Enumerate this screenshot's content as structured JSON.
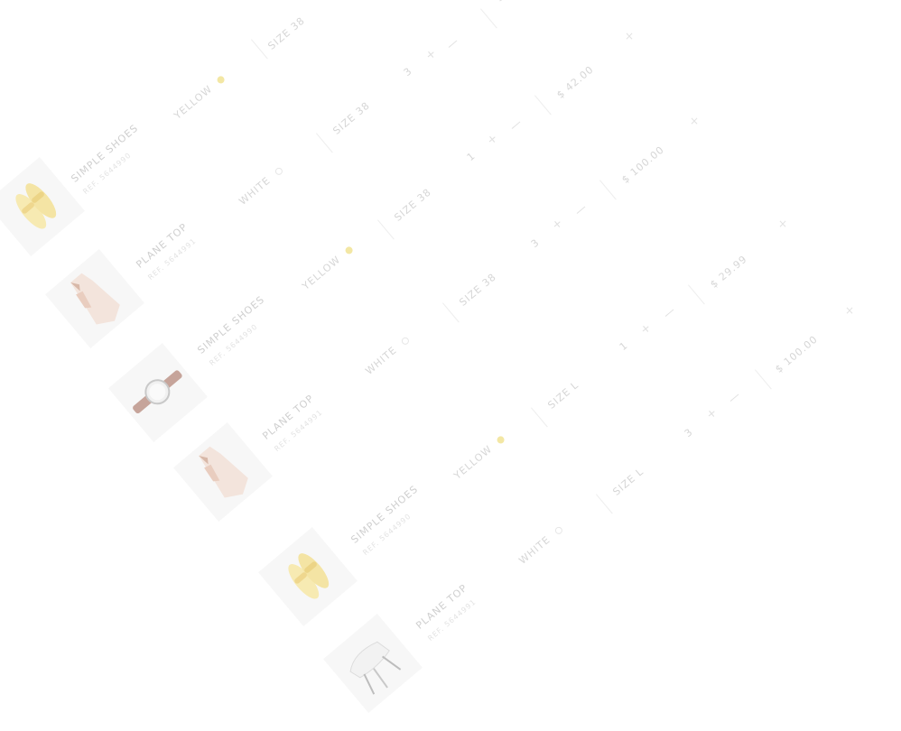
{
  "theme": {
    "accent_yellow": "#f3e7a4",
    "text_light": "#d6d6d6",
    "background": "#ffffff"
  },
  "cart": {
    "rows": [
      {
        "image": "sandals",
        "name": "SIMPLE SHOES",
        "ref": "REF. 5644990",
        "color": "YELLOW",
        "color_swatch": "#f3e7a4",
        "size": "SIZE 38",
        "quantity": "3",
        "price": "$ 42.00"
      },
      {
        "image": "top",
        "name": "PLANE TOP",
        "ref": "REF. 5644991",
        "color": "WHITE",
        "color_swatch": "#ffffff",
        "size": "SIZE 38",
        "quantity": "1",
        "price": "$ 100.00"
      },
      {
        "image": "watch",
        "name": "SIMPLE SHOES",
        "ref": "REF. 5644990",
        "color": "YELLOW",
        "color_swatch": "#f3e7a4",
        "size": "SIZE 38",
        "quantity": "3",
        "price": "$ 29.99"
      },
      {
        "image": "top",
        "name": "PLANE TOP",
        "ref": "REF. 5644991",
        "color": "WHITE",
        "color_swatch": "#ffffff",
        "size": "SIZE 38",
        "quantity": "1",
        "price": "$ 100.00"
      },
      {
        "image": "sandals",
        "name": "SIMPLE SHOES",
        "ref": "REF. 5644990",
        "color": "YELLOW",
        "color_swatch": "#f3e7a4",
        "size": "SIZE L",
        "quantity": "3",
        "price": ""
      },
      {
        "image": "chair",
        "name": "PLANE TOP",
        "ref": "REF. 5644991",
        "color": "WHITE",
        "color_swatch": "#ffffff",
        "size": "",
        "quantity": "",
        "price": ""
      }
    ],
    "partial_top_text": "3",
    "plus_label": "+",
    "minus_label": "—",
    "remove_label": "×"
  }
}
